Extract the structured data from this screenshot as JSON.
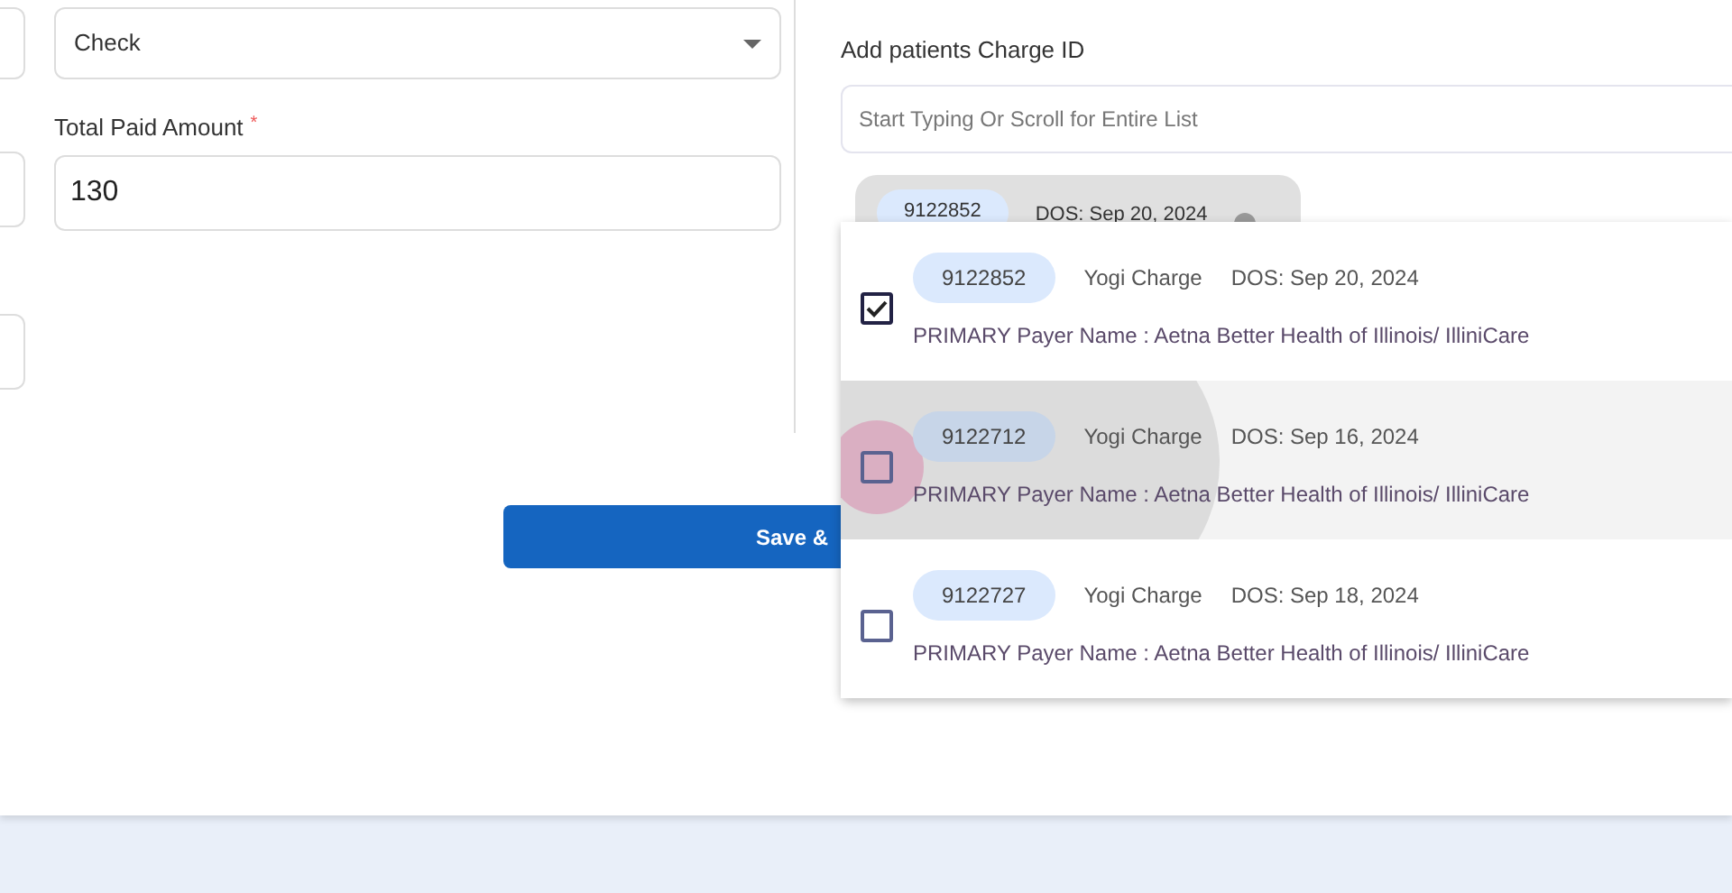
{
  "payment_method": {
    "value": "Check"
  },
  "total_paid": {
    "label": "Total Paid Amount",
    "required_mark": "*",
    "value": "130"
  },
  "save_button": {
    "label": "Save &"
  },
  "charge_picker": {
    "label": "Add patients Charge ID",
    "placeholder": "Start Typing Or Scroll for Entire List",
    "chips": [
      {
        "id": "9122852",
        "dos": "DOS: Sep 20, 2024"
      }
    ],
    "options": [
      {
        "id": "9122852",
        "name": "Yogi Charge",
        "dos": "DOS: Sep 20, 2024",
        "payer": "PRIMARY Payer Name : Aetna Better Health of Illinois/ IlliniCare",
        "checked": true,
        "highlighted": false
      },
      {
        "id": "9122712",
        "name": "Yogi Charge",
        "dos": "DOS: Sep 16, 2024",
        "payer": "PRIMARY Payer Name : Aetna Better Health of Illinois/ IlliniCare",
        "checked": false,
        "highlighted": true
      },
      {
        "id": "9122727",
        "name": "Yogi Charge",
        "dos": "DOS: Sep 18, 2024",
        "payer": "PRIMARY Payer Name : Aetna Better Health of Illinois/ IlliniCare",
        "checked": false,
        "highlighted": false
      }
    ]
  }
}
